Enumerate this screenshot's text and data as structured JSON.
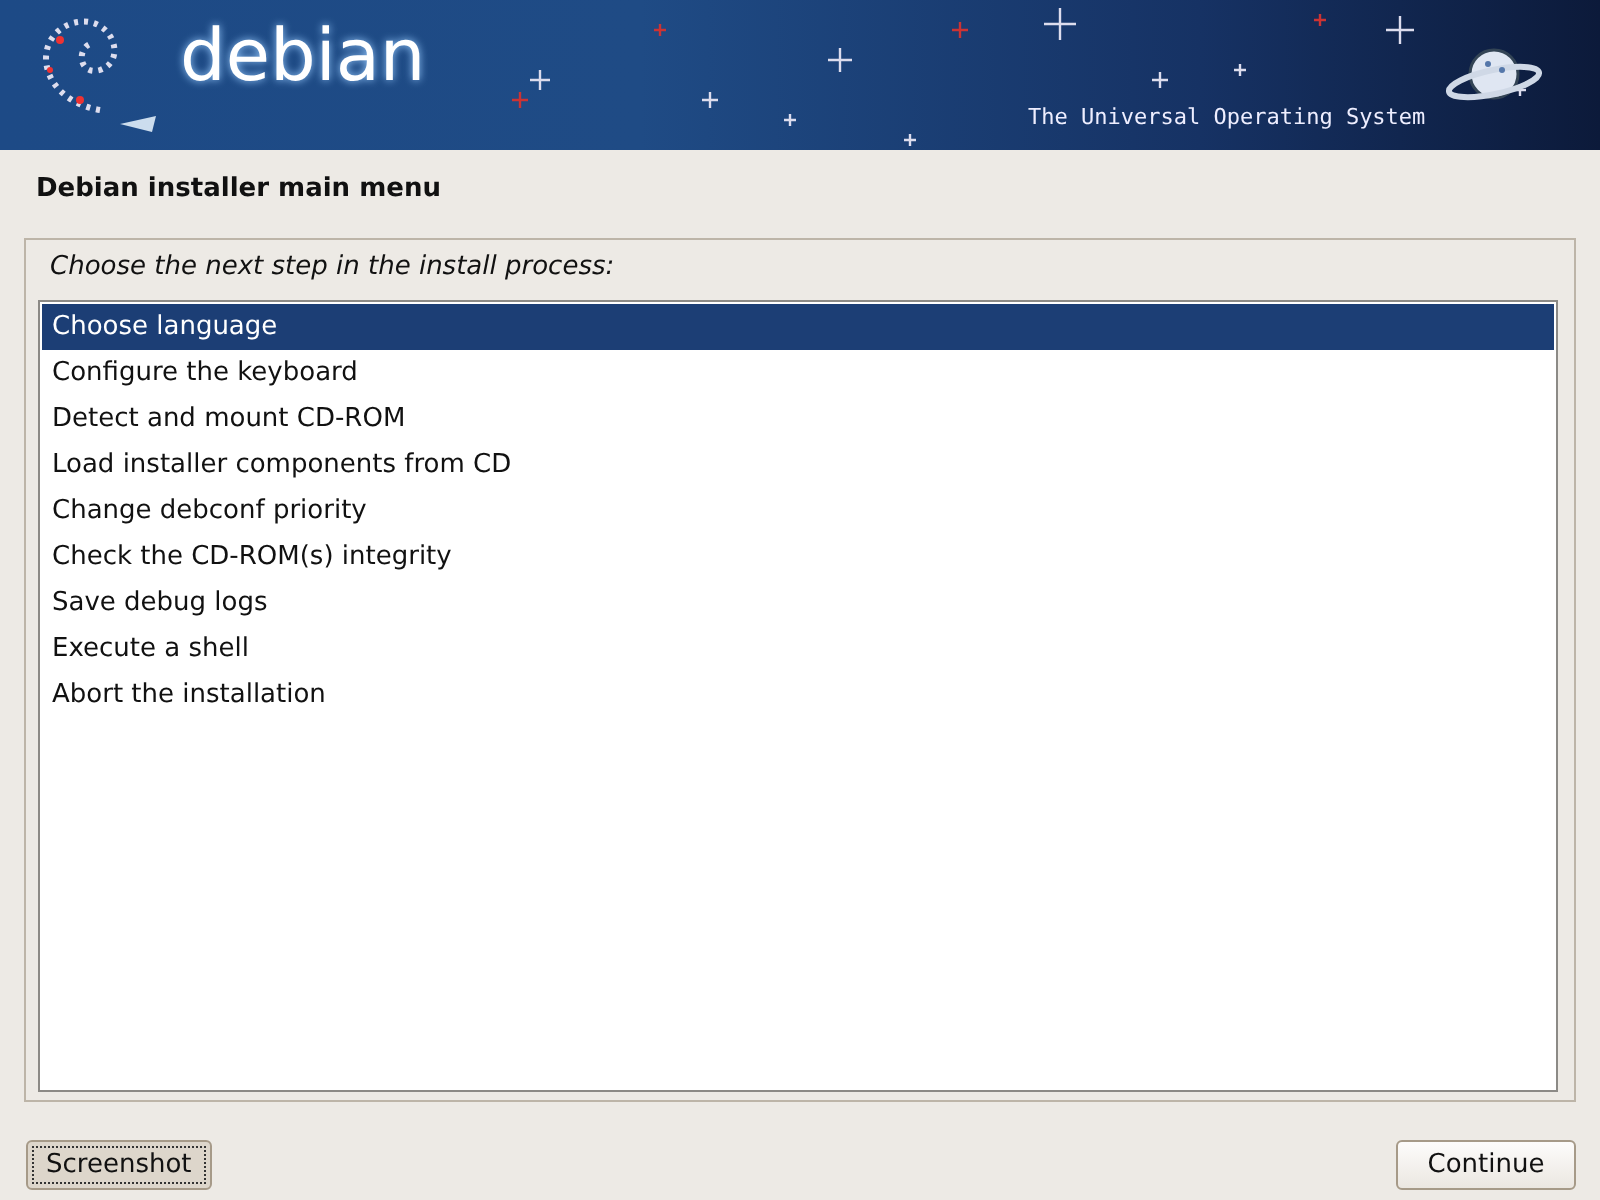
{
  "banner": {
    "logo": "debian",
    "tagline": "The Universal Operating System"
  },
  "title": "Debian installer main menu",
  "prompt": "Choose the next step in the install process:",
  "items": [
    {
      "label": "Choose language",
      "selected": true
    },
    {
      "label": "Configure the keyboard",
      "selected": false
    },
    {
      "label": "Detect and mount CD-ROM",
      "selected": false
    },
    {
      "label": "Load installer components from CD",
      "selected": false
    },
    {
      "label": "Change debconf priority",
      "selected": false
    },
    {
      "label": "Check the CD-ROM(s) integrity",
      "selected": false
    },
    {
      "label": "Save debug logs",
      "selected": false
    },
    {
      "label": "Execute a shell",
      "selected": false
    },
    {
      "label": "Abort the installation",
      "selected": false
    }
  ],
  "buttons": [
    {
      "label": "Screenshot",
      "focused": true
    },
    {
      "label": "Continue",
      "focused": false
    }
  ]
}
